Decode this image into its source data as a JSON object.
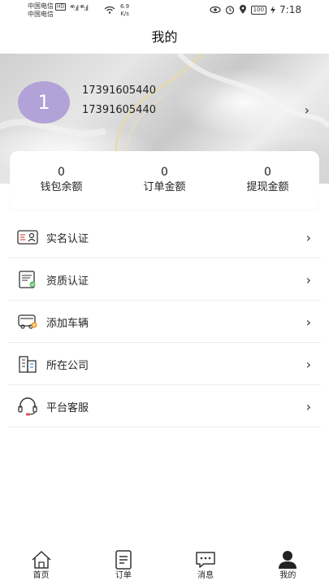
{
  "status_bar": {
    "carrier_1": "中国电信",
    "hd_badge": "HD",
    "carrier_2": "中国电信",
    "signal": "⁴⁶.ıl ⁴⁶.ıl",
    "speed_value": "6.9",
    "speed_unit": "K/s",
    "battery": "100",
    "time": "7:18"
  },
  "header": {
    "title": "我的"
  },
  "profile": {
    "avatar_text": "1",
    "phone_primary": "17391605440",
    "phone_secondary": "17391605440",
    "chevron": "›"
  },
  "stats": [
    {
      "value": "0",
      "label": "钱包余额"
    },
    {
      "value": "0",
      "label": "订单金额"
    },
    {
      "value": "0",
      "label": "提现金额"
    }
  ],
  "menu": [
    {
      "label": "实名认证",
      "icon": "id-card-icon"
    },
    {
      "label": "资质认证",
      "icon": "certificate-icon"
    },
    {
      "label": "添加车辆",
      "icon": "vehicle-icon"
    },
    {
      "label": "所在公司",
      "icon": "building-icon"
    },
    {
      "label": "平台客服",
      "icon": "headset-icon"
    }
  ],
  "menu_chevron": "›",
  "bottom_nav": [
    {
      "label": "首页",
      "icon": "home-icon",
      "active": false
    },
    {
      "label": "订单",
      "icon": "order-icon",
      "active": false
    },
    {
      "label": "消息",
      "icon": "message-icon",
      "active": false
    },
    {
      "label": "我的",
      "icon": "profile-icon",
      "active": true
    }
  ],
  "colors": {
    "avatar_bg": "#b3a2d8",
    "accent_green": "#5fbf6a",
    "accent_orange": "#f0a030",
    "accent_red": "#e05050"
  }
}
